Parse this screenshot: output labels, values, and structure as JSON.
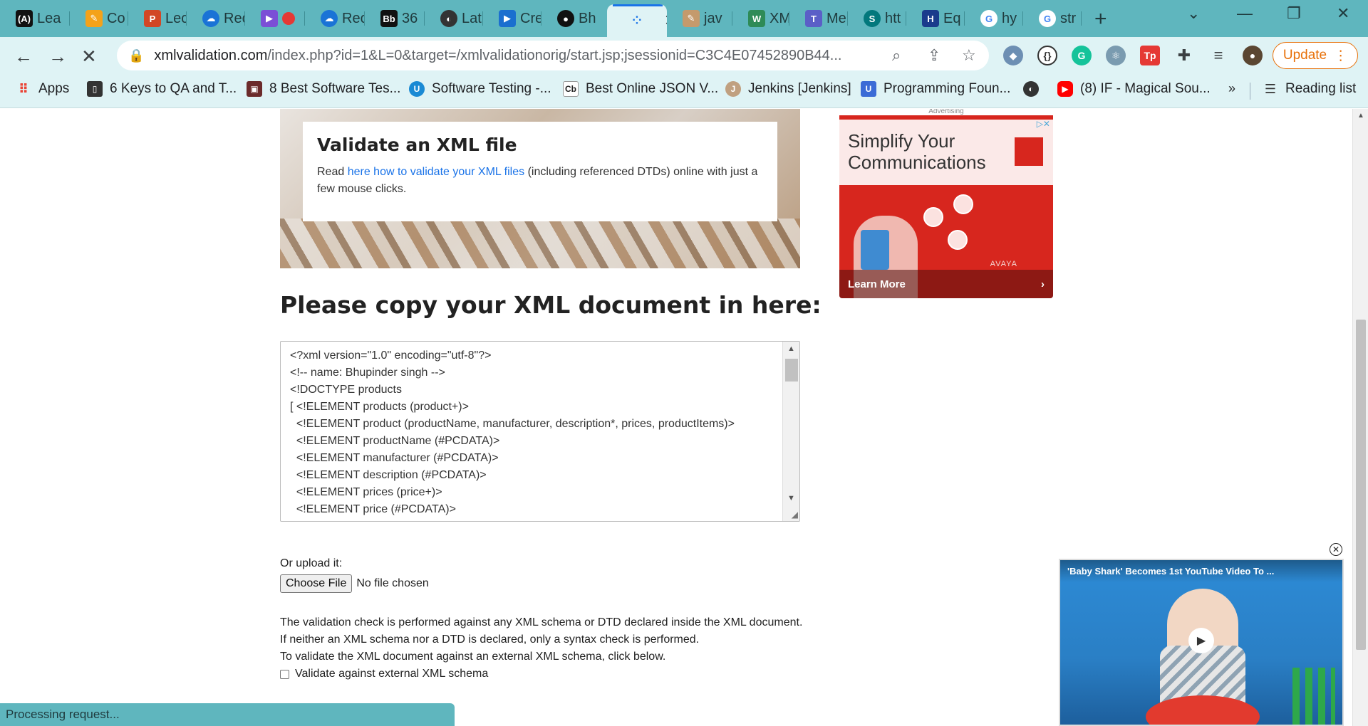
{
  "tabs": [
    {
      "label": "Lea",
      "icon": "ai-icon",
      "color": "#111111"
    },
    {
      "label": "Co",
      "icon": "pencil-icon",
      "color": "#f4a21a"
    },
    {
      "label": "Lec",
      "icon": "powerpoint-icon",
      "color": "#d24726"
    },
    {
      "label": "Rec",
      "icon": "onedrive-icon",
      "color": "#1a73d6"
    },
    {
      "label": "",
      "icon": "stream-icon",
      "color": "#7b4fd6"
    },
    {
      "label": "Rec",
      "icon": "onedrive-icon",
      "color": "#1a73d6"
    },
    {
      "label": "36",
      "icon": "blackboard-icon",
      "color": "#111111"
    },
    {
      "label": "Lat",
      "icon": "globe-icon",
      "color": "#333333"
    },
    {
      "label": "Cre",
      "icon": "video-icon",
      "color": "#1b6fcf"
    },
    {
      "label": "Bh",
      "icon": "github-icon",
      "color": "#111111"
    },
    {
      "label": "",
      "icon": "loading-icon",
      "color": "#1a73e8",
      "active": true
    },
    {
      "label": "jav",
      "icon": "pencil-icon",
      "color": "#c49a6c"
    },
    {
      "label": "XM",
      "icon": "w3-icon",
      "color": "#2e8b57"
    },
    {
      "label": "Me",
      "icon": "teams-icon",
      "color": "#5b5fc7"
    },
    {
      "label": "htt",
      "icon": "sharepoint-icon",
      "color": "#03787c"
    },
    {
      "label": "Eq",
      "icon": "hp-icon",
      "color": "#e6a100"
    },
    {
      "label": "hy",
      "icon": "google-icon",
      "color": "#4285f4"
    },
    {
      "label": "str",
      "icon": "google-icon",
      "color": "#4285f4"
    }
  ],
  "toolbar": {
    "url_host": "xmlvalidation.com",
    "url_path": "/index.php?id=1&L=0&target=/xmlvalidationorig/start.jsp;jsessionid=C3C4E07452890B44...",
    "update_label": "Update"
  },
  "bookmarks": [
    {
      "label": "Apps",
      "icon": "apps-grid-icon",
      "color": "#ea4335"
    },
    {
      "label": "6 Keys to QA and T...",
      "icon": "tablet-icon",
      "color": "#333333"
    },
    {
      "label": "8 Best Software Tes...",
      "icon": "book-icon",
      "color": "#6b2b2b"
    },
    {
      "label": "Software Testing -...",
      "icon": "u-icon",
      "color": "#1a8ad4"
    },
    {
      "label": "Best Online JSON V...",
      "icon": "cb-icon",
      "color": "#222222"
    },
    {
      "label": "Jenkins [Jenkins]",
      "icon": "jenkins-icon",
      "color": "#c0a080"
    },
    {
      "label": "Programming Foun...",
      "icon": "udemy-icon",
      "color": "#3b6bd6"
    },
    {
      "label": "",
      "icon": "globe-icon",
      "color": "#333333"
    },
    {
      "label": "(8) IF - Magical Sou...",
      "icon": "youtube-icon",
      "color": "#ff0000"
    }
  ],
  "reading_list_label": "Reading list",
  "hero": {
    "title": "Validate an XML file",
    "text_before": "Read ",
    "link": "here how to validate your XML files",
    "text_after": " (including referenced DTDs) online with just a few mouse clicks."
  },
  "section_title": "Please copy your XML document in here:",
  "xml_lines": [
    "<?xml version=\"1.0\" encoding=\"utf-8\"?>",
    "<!-- name: Bhupinder singh -->",
    "<!DOCTYPE products",
    "[ <!ELEMENT products (product+)>",
    "  <!ELEMENT product (productName, manufacturer, description*, prices, productItems)>",
    "  <!ELEMENT productName (#PCDATA)>",
    "  <!ELEMENT manufacturer (#PCDATA)>",
    "  <!ELEMENT description (#PCDATA)>",
    "  <!ELEMENT prices (price+)>",
    "  <!ELEMENT price (#PCDATA)>"
  ],
  "upload": {
    "label": "Or upload it:",
    "button": "Choose File",
    "status": "No file chosen"
  },
  "info_lines": [
    "The validation check is performed against any XML schema or DTD declared inside the XML document.",
    "If neither an XML schema nor a DTD is declared, only a syntax check is performed.",
    "To validate the XML document against an external XML schema, click below."
  ],
  "checkbox_label": "Validate against external XML schema",
  "ad": {
    "label": "Advertising",
    "headline_1": "Simplify Your",
    "headline_2": "Communications",
    "brand": "AVAYA",
    "cta": "Learn More"
  },
  "video": {
    "title": "'Baby Shark' Becomes 1st YouTube Video To ..."
  },
  "status": "Processing request..."
}
